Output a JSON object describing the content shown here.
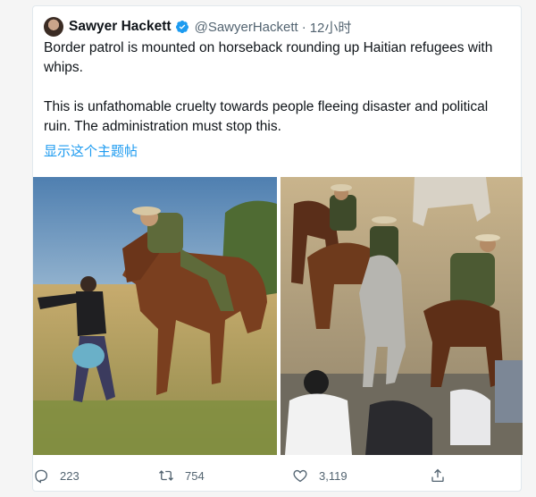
{
  "tweet": {
    "display_name": "Sawyer Hackett",
    "handle": "@SawyerHackett",
    "separator": "·",
    "time": "12小时",
    "paragraph1": "Border patrol is mounted on horseback rounding up Haitian refugees with whips.",
    "paragraph2": "This is unfathomable cruelty towards people fleeing disaster and political ruin. The administration must stop this.",
    "translate_link": "显示这个主题帖"
  },
  "actions": {
    "replies": "223",
    "retweets": "754",
    "likes": "3,119"
  },
  "colors": {
    "accent": "#1d9bf0",
    "muted": "#536471",
    "text": "#0f1419",
    "verified": "#1d9bf0"
  },
  "icons": [
    "verified-badge-icon",
    "reply-icon",
    "retweet-icon",
    "like-icon",
    "share-icon"
  ]
}
